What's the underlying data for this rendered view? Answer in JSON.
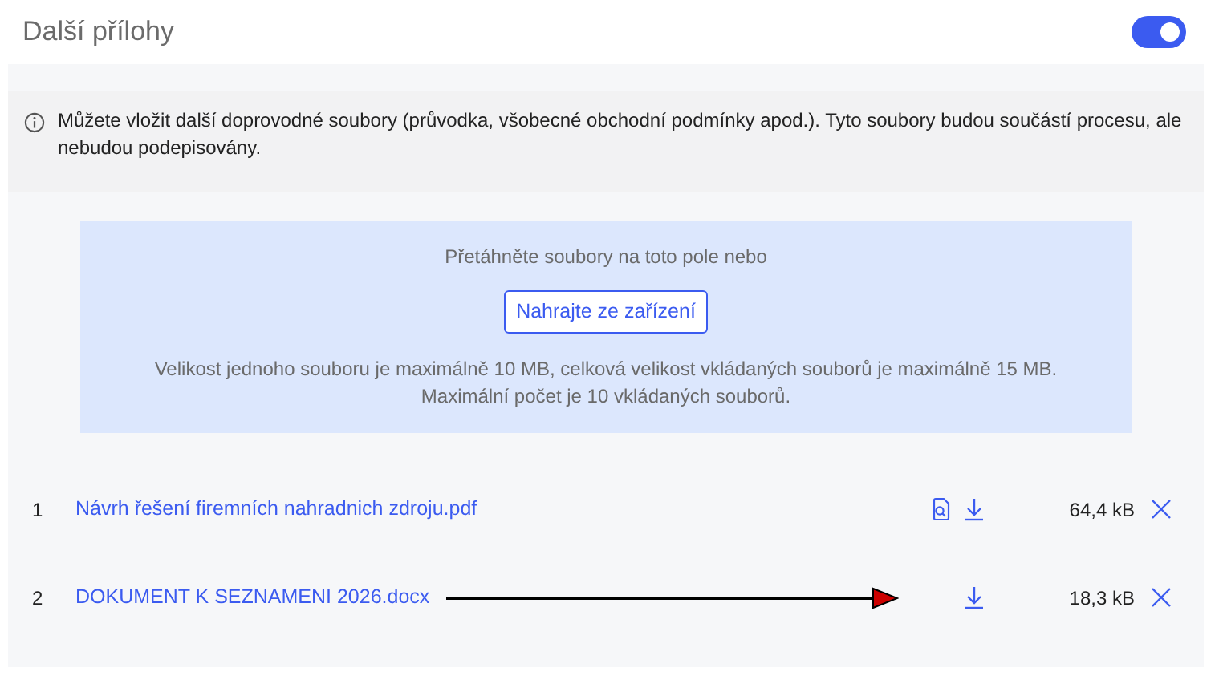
{
  "title": "Další přílohy",
  "toggle": {
    "on": true
  },
  "info": {
    "text": "Můžete vložit další doprovodné soubory (průvodka, všobecné obchodní podmínky apod.). Tyto soubory budou součástí procesu, ale nebudou podepisovány."
  },
  "dropzone": {
    "hint": "Přetáhněte soubory na toto pole nebo",
    "button": "Nahrajte ze zařízení",
    "limits": [
      "Velikost jednoho souboru je maximálně 10 MB, celková velikost vkládaných souborů je maximálně 15 MB.",
      "Maximální počet je 10 vkládaných souborů."
    ]
  },
  "files": [
    {
      "index": "1",
      "name": "Návrh řešení firemních nahradnich zdroju.pdf",
      "preview": true,
      "annotated": false,
      "size": "64,4 kB"
    },
    {
      "index": "2",
      "name": "DOKUMENT K SEZNAMENI 2026.docx",
      "preview": false,
      "annotated": true,
      "size": "18,3 kB"
    }
  ]
}
